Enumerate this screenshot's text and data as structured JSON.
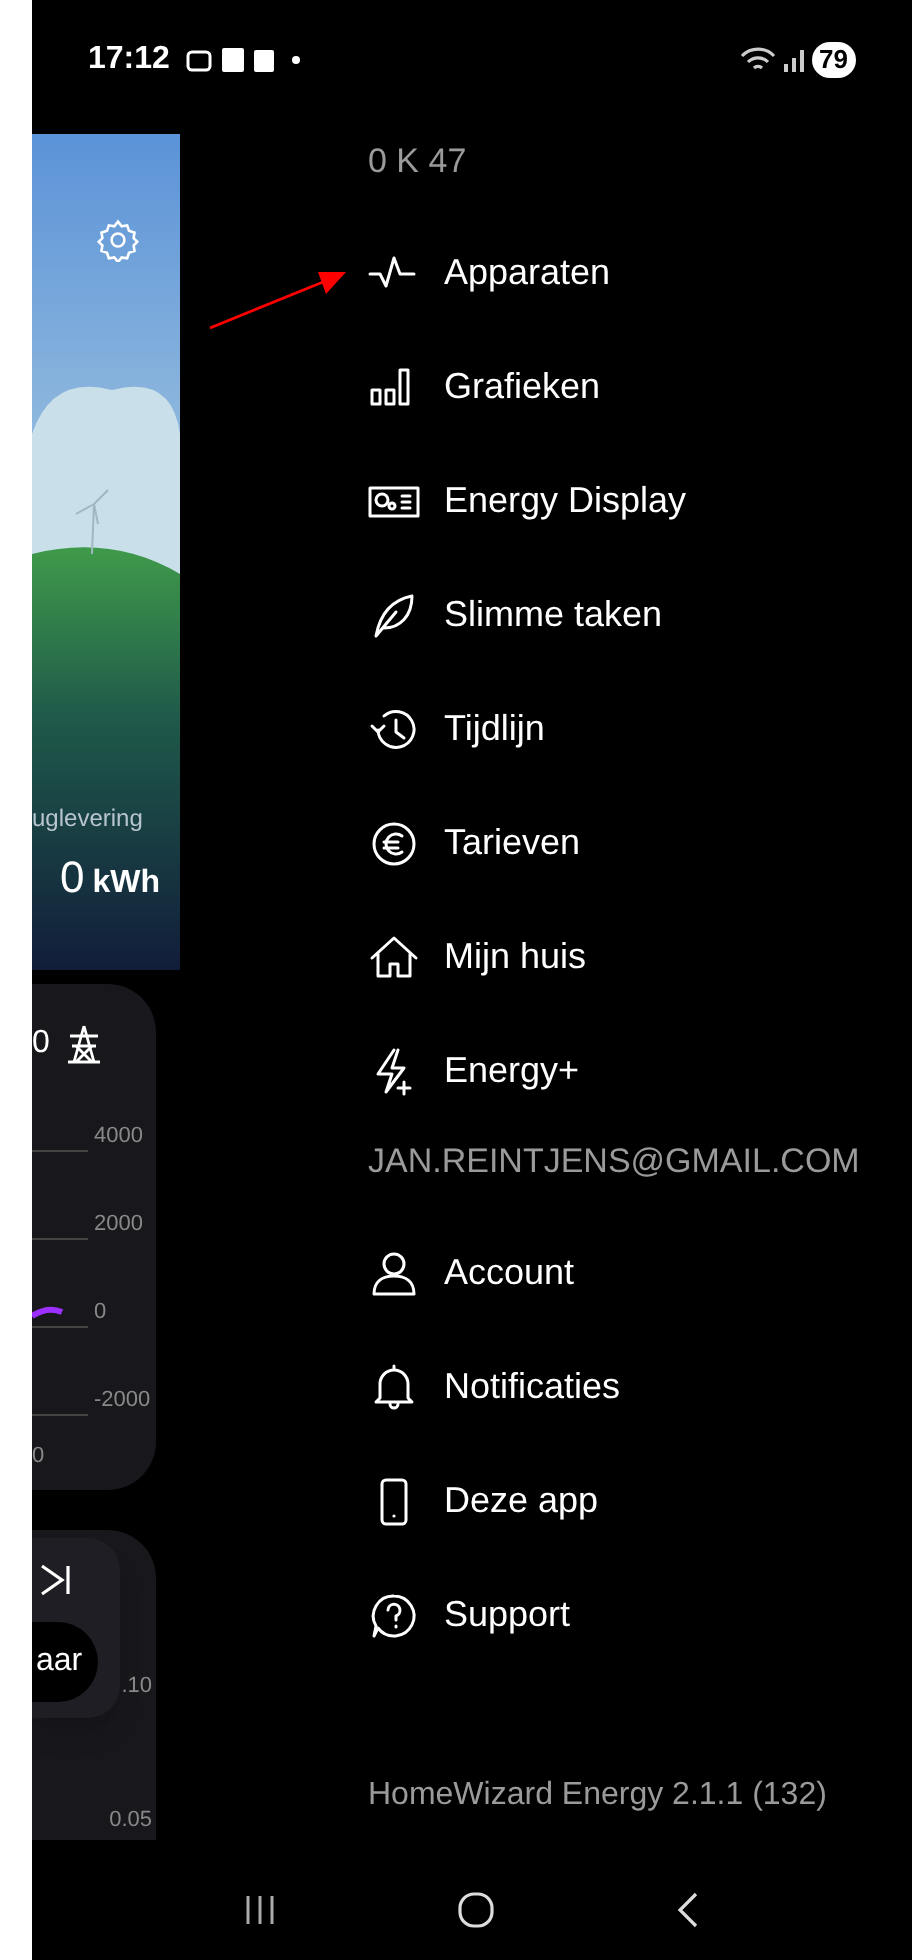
{
  "status_bar": {
    "time": "17:12",
    "battery": "79"
  },
  "background": {
    "energy_label": "uglevering",
    "energy_value": "0",
    "energy_unit": "kWh",
    "power_value": "0",
    "y_ticks": [
      "4000",
      "2000",
      "0",
      "-2000"
    ],
    "x_tick": "0",
    "button_label": "aar",
    "price_ticks": [
      ".10",
      "0.05"
    ]
  },
  "drawer": {
    "title": "0 K 47",
    "items": [
      {
        "label": "Apparaten"
      },
      {
        "label": "Grafieken"
      },
      {
        "label": "Energy Display"
      },
      {
        "label": "Slimme taken"
      },
      {
        "label": "Tijdlijn"
      },
      {
        "label": "Tarieven"
      },
      {
        "label": "Mijn huis"
      },
      {
        "label": "Energy+"
      }
    ],
    "account_header": "JAN.REINTJENS@GMAIL.COM",
    "account_items": [
      {
        "label": "Account"
      },
      {
        "label": "Notificaties"
      },
      {
        "label": "Deze app"
      },
      {
        "label": "Support"
      }
    ],
    "footer": "HomeWizard Energy 2.1.1 (132)"
  }
}
